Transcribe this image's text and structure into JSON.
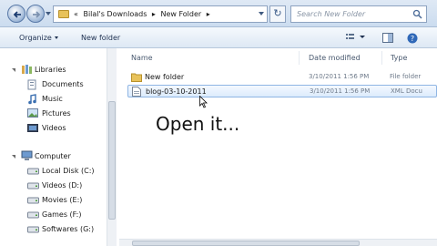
{
  "address": {
    "crumbs": [
      "«",
      "Bilal's Downloads",
      "▸",
      "New Folder",
      "▸"
    ],
    "search_placeholder": "Search New Folder"
  },
  "toolbar": {
    "organize_label": "Organize",
    "new_folder_label": "New folder"
  },
  "nav": {
    "libraries": "Libraries",
    "documents": "Documents",
    "music": "Music",
    "pictures": "Pictures",
    "videos": "Videos",
    "computer": "Computer",
    "local_disk": "Local Disk (C:)",
    "videos_d": "Videos (D:)",
    "movies_e": "Movies (E:)",
    "games_f": "Games (F:)",
    "softwares_g": "Softwares (G:)"
  },
  "columns": {
    "name": "Name",
    "date": "Date modified",
    "type": "Type"
  },
  "files": [
    {
      "name": "New folder",
      "date": "3/10/2011 1:56 PM",
      "type": "File folder",
      "icon": "folder-icon"
    },
    {
      "name": "blog-03-10-2011",
      "date": "3/10/2011 1:56 PM",
      "type": "XML Docu",
      "icon": "document-icon",
      "selected": true
    }
  ],
  "caption": "Open it...",
  "colors": {
    "folder": "#e8c25a",
    "selection": "#dcebfc",
    "chrome": "#cbdcef"
  }
}
